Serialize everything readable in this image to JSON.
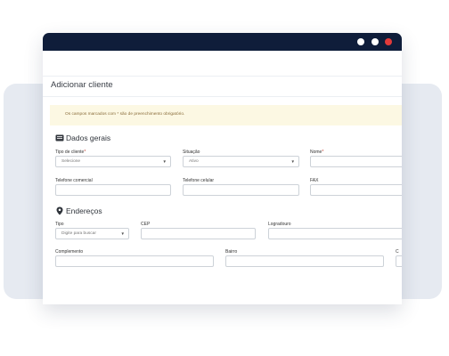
{
  "page": {
    "title": "Adicionar cliente"
  },
  "alert": {
    "text": "Os campos marcados com * são de preenchimento obrigatório."
  },
  "window": {
    "dots": [
      "dot-white",
      "dot-white",
      "dot-red"
    ]
  },
  "colors": {
    "titlebar": "#0f1d3a",
    "close_dot": "#e23a3a",
    "alert_bg": "#fcf8e3",
    "background_card": "#e6eaf1"
  },
  "sections": {
    "general": {
      "title": "Dados gerais",
      "icon": "id-card-icon"
    },
    "address": {
      "title": "Endereços",
      "icon": "map-marker-icon"
    }
  },
  "fields": {
    "tipo_cliente": {
      "label": "Tipo de cliente",
      "required": "*",
      "value": "Selecione"
    },
    "situacao": {
      "label": "Situação",
      "value": "Ativo"
    },
    "nome": {
      "label": "Nome",
      "required": "*",
      "value": ""
    },
    "tel_comercial": {
      "label": "Telefone comercial",
      "value": ""
    },
    "tel_celular": {
      "label": "Telefone celular",
      "value": ""
    },
    "fax": {
      "label": "FAX",
      "value": ""
    },
    "tipo": {
      "label": "Tipo",
      "placeholder": "Digite para buscar"
    },
    "cep": {
      "label": "CEP",
      "value": ""
    },
    "logradouro": {
      "label": "Logradouro",
      "value": ""
    },
    "complemento": {
      "label": "Complemento",
      "value": ""
    },
    "bairro": {
      "label": "Bairro",
      "value": ""
    },
    "cutoff": {
      "label": "C"
    }
  }
}
